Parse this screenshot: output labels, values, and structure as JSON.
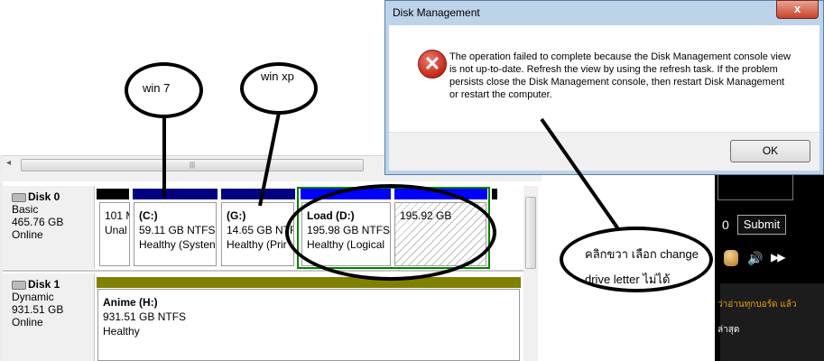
{
  "dialog": {
    "title": "Disk Management",
    "close_label": "x",
    "message": "The operation failed to complete because the Disk Management console view is not up-to-date.  Refresh the view by using the refresh task. If the problem persists close the Disk Management console, then restart Disk Management or restart the computer.",
    "ok_label": "OK"
  },
  "scrollbar": {
    "left_arrow": "◂",
    "thumb_grip": "|||"
  },
  "disks": [
    {
      "name": "Disk 0",
      "type": "Basic",
      "size": "465.76 GB",
      "status": "Online",
      "partitions": [
        {
          "name": "",
          "line1": "101 M",
          "line2": "Unal"
        },
        {
          "name": "(C:)",
          "line1": "59.11 GB NTFS",
          "line2": "Healthy (Systen"
        },
        {
          "name": "(G:)",
          "line1": "14.65 GB NTFS",
          "line2": "Healthy (Prir"
        },
        {
          "name": "Load  (D:)",
          "line1": "195.98 GB NTFS",
          "line2": "Healthy (Logical"
        },
        {
          "name": "",
          "line1": "195.92 GB",
          "line2": ""
        }
      ]
    },
    {
      "name": "Disk 1",
      "type": "Dynamic",
      "size": "931.51 GB",
      "status": "Online",
      "partitions": [
        {
          "name": "Anime  (H:)",
          "line1": "931.51 GB NTFS",
          "line2": "Healthy"
        }
      ]
    }
  ],
  "annotations": {
    "win7": "win 7",
    "winxp": "win xp",
    "note_line1": "คลิกขวา  เลือก change",
    "note_line2": "drive letter ไม่ได้"
  },
  "side_panel": {
    "zero": "0",
    "submit_label": "Submit",
    "ff_icon": "▶▶",
    "thai_line1": "ว่าอ่านทุกบอร์ด แล้ว",
    "thai_line2": "ล่าสุด"
  },
  "colors": {
    "primary_partition": "#000080",
    "logical_partition": "#0000ff",
    "dynamic_volume": "#808000",
    "unallocated": "#000000",
    "extended_border": "#008000"
  }
}
